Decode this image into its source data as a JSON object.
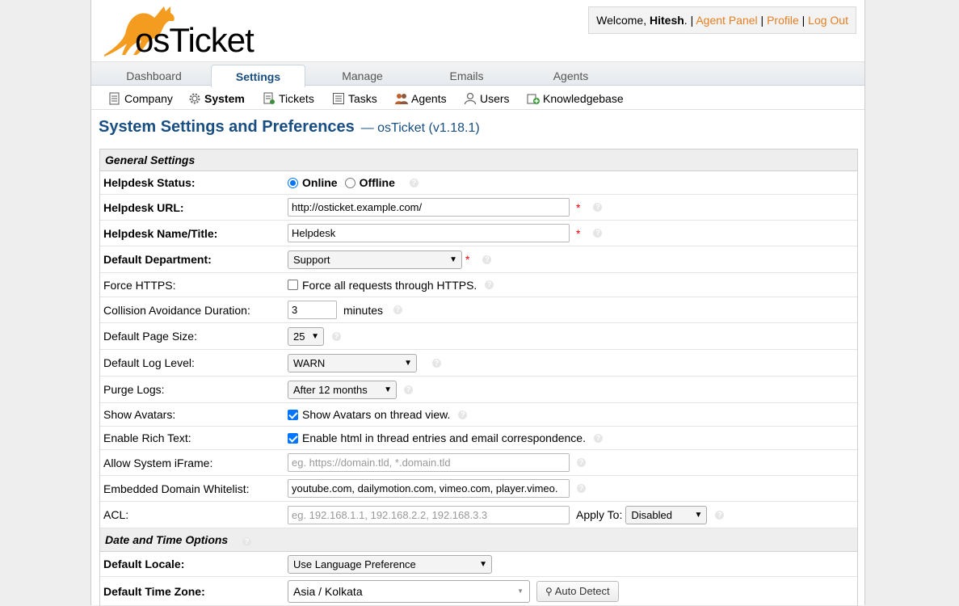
{
  "header": {
    "logo_text": "osTicket",
    "welcome": "Welcome, ",
    "user_name": "Hitesh",
    "sep1": ". | ",
    "agent_panel": "Agent Panel",
    "sep2": " | ",
    "profile": "Profile",
    "sep3": " | ",
    "logout": "Log Out"
  },
  "tabs": [
    {
      "label": "Dashboard"
    },
    {
      "label": "Settings"
    },
    {
      "label": "Manage"
    },
    {
      "label": "Emails"
    },
    {
      "label": "Agents"
    }
  ],
  "subnav": [
    {
      "label": "Company",
      "icon": "company-icon"
    },
    {
      "label": "System",
      "icon": "gear-icon"
    },
    {
      "label": "Tickets",
      "icon": "tickets-icon"
    },
    {
      "label": "Tasks",
      "icon": "tasks-icon"
    },
    {
      "label": "Agents",
      "icon": "agents-icon"
    },
    {
      "label": "Users",
      "icon": "users-icon"
    },
    {
      "label": "Knowledgebase",
      "icon": "knowledgebase-icon"
    }
  ],
  "page": {
    "title": "System Settings and Preferences",
    "subtitle": "— osTicket (v1.18.1)"
  },
  "general": {
    "section_title": "General Settings",
    "helpdesk_status": {
      "label": "Helpdesk Status:",
      "online": "Online",
      "offline": "Offline"
    },
    "helpdesk_url": {
      "label": "Helpdesk URL:",
      "value": "http://osticket.example.com/"
    },
    "helpdesk_name": {
      "label": "Helpdesk Name/Title:",
      "value": "Helpdesk"
    },
    "default_department": {
      "label": "Default Department:",
      "value": "Support"
    },
    "force_https": {
      "label": "Force HTTPS:",
      "text": "Force all requests through HTTPS."
    },
    "collision": {
      "label": "Collision Avoidance Duration:",
      "value": "3",
      "unit": "minutes"
    },
    "page_size": {
      "label": "Default Page Size:",
      "value": "25"
    },
    "log_level": {
      "label": "Default Log Level:",
      "value": "WARN"
    },
    "purge_logs": {
      "label": "Purge Logs:",
      "value": "After 12 months"
    },
    "show_avatars": {
      "label": "Show Avatars:",
      "text": "Show Avatars on thread view."
    },
    "rich_text": {
      "label": "Enable Rich Text:",
      "text": "Enable html in thread entries and email correspondence."
    },
    "iframe": {
      "label": "Allow System iFrame:",
      "placeholder": "eg. https://domain.tld, *.domain.tld"
    },
    "whitelist": {
      "label": "Embedded Domain Whitelist:",
      "value": "youtube.com, dailymotion.com, vimeo.com, player.vimeo."
    },
    "acl": {
      "label": "ACL:",
      "placeholder": "eg. 192.168.1.1, 192.168.2.2, 192.168.3.3",
      "apply_label": "Apply To:",
      "apply_value": "Disabled"
    }
  },
  "datetime": {
    "section_title": "Date and Time Options",
    "locale": {
      "label": "Default Locale:",
      "value": "Use Language Preference"
    },
    "timezone": {
      "label": "Default Time Zone:",
      "value": "Asia / Kolkata",
      "detect": "Auto Detect"
    }
  },
  "colors": {
    "brand": "#184e81",
    "link": "#e67e22",
    "required": "#e00000"
  }
}
